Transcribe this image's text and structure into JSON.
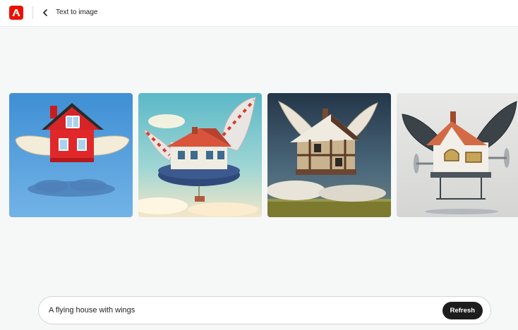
{
  "header": {
    "app_logo_icon": "adobe-firefly-logo-icon",
    "back_icon": "chevron-left-icon",
    "title": "Text to image"
  },
  "gallery": {
    "images": [
      {
        "icon": "red-house-with-wings-image"
      },
      {
        "icon": "house-on-blimp-with-wings-image"
      },
      {
        "icon": "tudor-house-with-wings-image"
      },
      {
        "icon": "house-with-propellers-and-dark-wings-image"
      }
    ]
  },
  "prompt": {
    "value": "A flying house with wings",
    "button_label": "Refresh"
  },
  "colors": {
    "brand": "#eb1000",
    "background": "#f6f7f7",
    "button": "#1d1d1d"
  }
}
